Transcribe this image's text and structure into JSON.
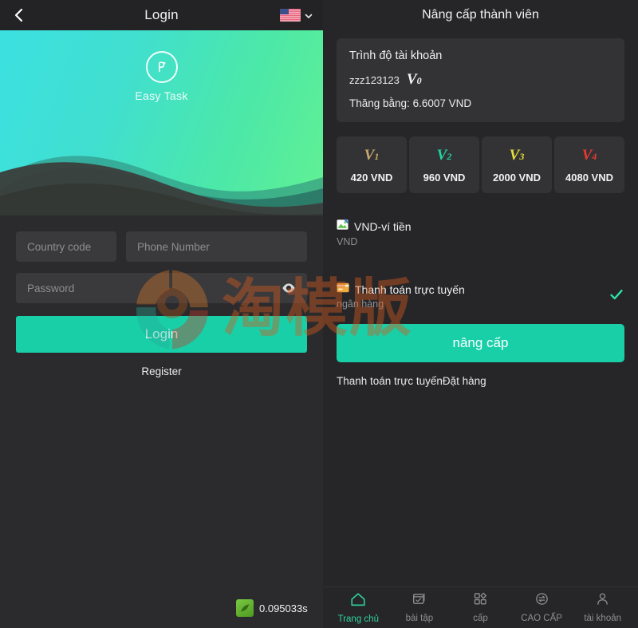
{
  "login": {
    "header": {
      "title": "Login",
      "back_icon": "chevron-left-icon",
      "language_flag": "us-flag-icon",
      "language_chevron": "chevron-down-icon"
    },
    "hero": {
      "brand_name": "Easy Task",
      "logo_icon": "easy-task-logo-icon"
    },
    "form": {
      "country_placeholder": "Country code",
      "country_value": "",
      "phone_placeholder": "Phone Number",
      "phone_value": "",
      "password_placeholder": "Password",
      "password_value": "",
      "toggle_password_icon": "eye-icon",
      "login_label": "Login",
      "register_label": "Register"
    },
    "speed": {
      "icon": "leaf-speed-icon",
      "value": "0.095033s"
    }
  },
  "watermark": {
    "text": "淘模版",
    "mark_icon": "watermark-logo-icon",
    "color": "#d65a1e"
  },
  "upgrade": {
    "header": {
      "title": "Nâng cấp thành viên"
    },
    "account": {
      "title": "Trình độ tài khoản",
      "username": "zzz123123",
      "level_letter": "V",
      "level_number": "0",
      "balance_label": "Thăng bằng:",
      "balance_value": "6.6007 VND"
    },
    "tiers": [
      {
        "letter": "V",
        "number": "1",
        "price": "420 VND",
        "color": "#c8a86b"
      },
      {
        "letter": "V",
        "number": "2",
        "price": "960 VND",
        "color": "#1fd6a0"
      },
      {
        "letter": "V",
        "number": "3",
        "price": "2000 VND",
        "color": "#e6dd3c"
      },
      {
        "letter": "V",
        "number": "4",
        "price": "4080 VND",
        "color": "#e8392f"
      }
    ],
    "payment_methods": [
      {
        "icon": "broken-image-icon",
        "name": "VND-ví tiền",
        "sub": "VND",
        "selected": false,
        "check_icon": ""
      },
      {
        "icon": "credit-card-icon",
        "name": "Thanh toán trực tuyến",
        "sub": "ngân hàng",
        "selected": true,
        "check_icon": "check-icon"
      }
    ],
    "submit_label": "nâng cấp",
    "order_note": "Thanh toán trực tuyếnĐặt hàng"
  },
  "bottom_nav": [
    {
      "label": "Trang chủ",
      "icon": "home-icon",
      "active": true
    },
    {
      "label": "bài tập",
      "icon": "task-window-icon",
      "active": false
    },
    {
      "label": "cấp",
      "icon": "apps-grid-icon",
      "active": false
    },
    {
      "label": "CAO CẤP",
      "icon": "exchange-circle-icon",
      "active": false
    },
    {
      "label": "tài khoản",
      "icon": "person-icon",
      "active": false
    }
  ],
  "theme": {
    "accent": "#18cfa8",
    "page_bg": "#262628",
    "card_bg": "#333335",
    "header_bg": "#232325"
  }
}
